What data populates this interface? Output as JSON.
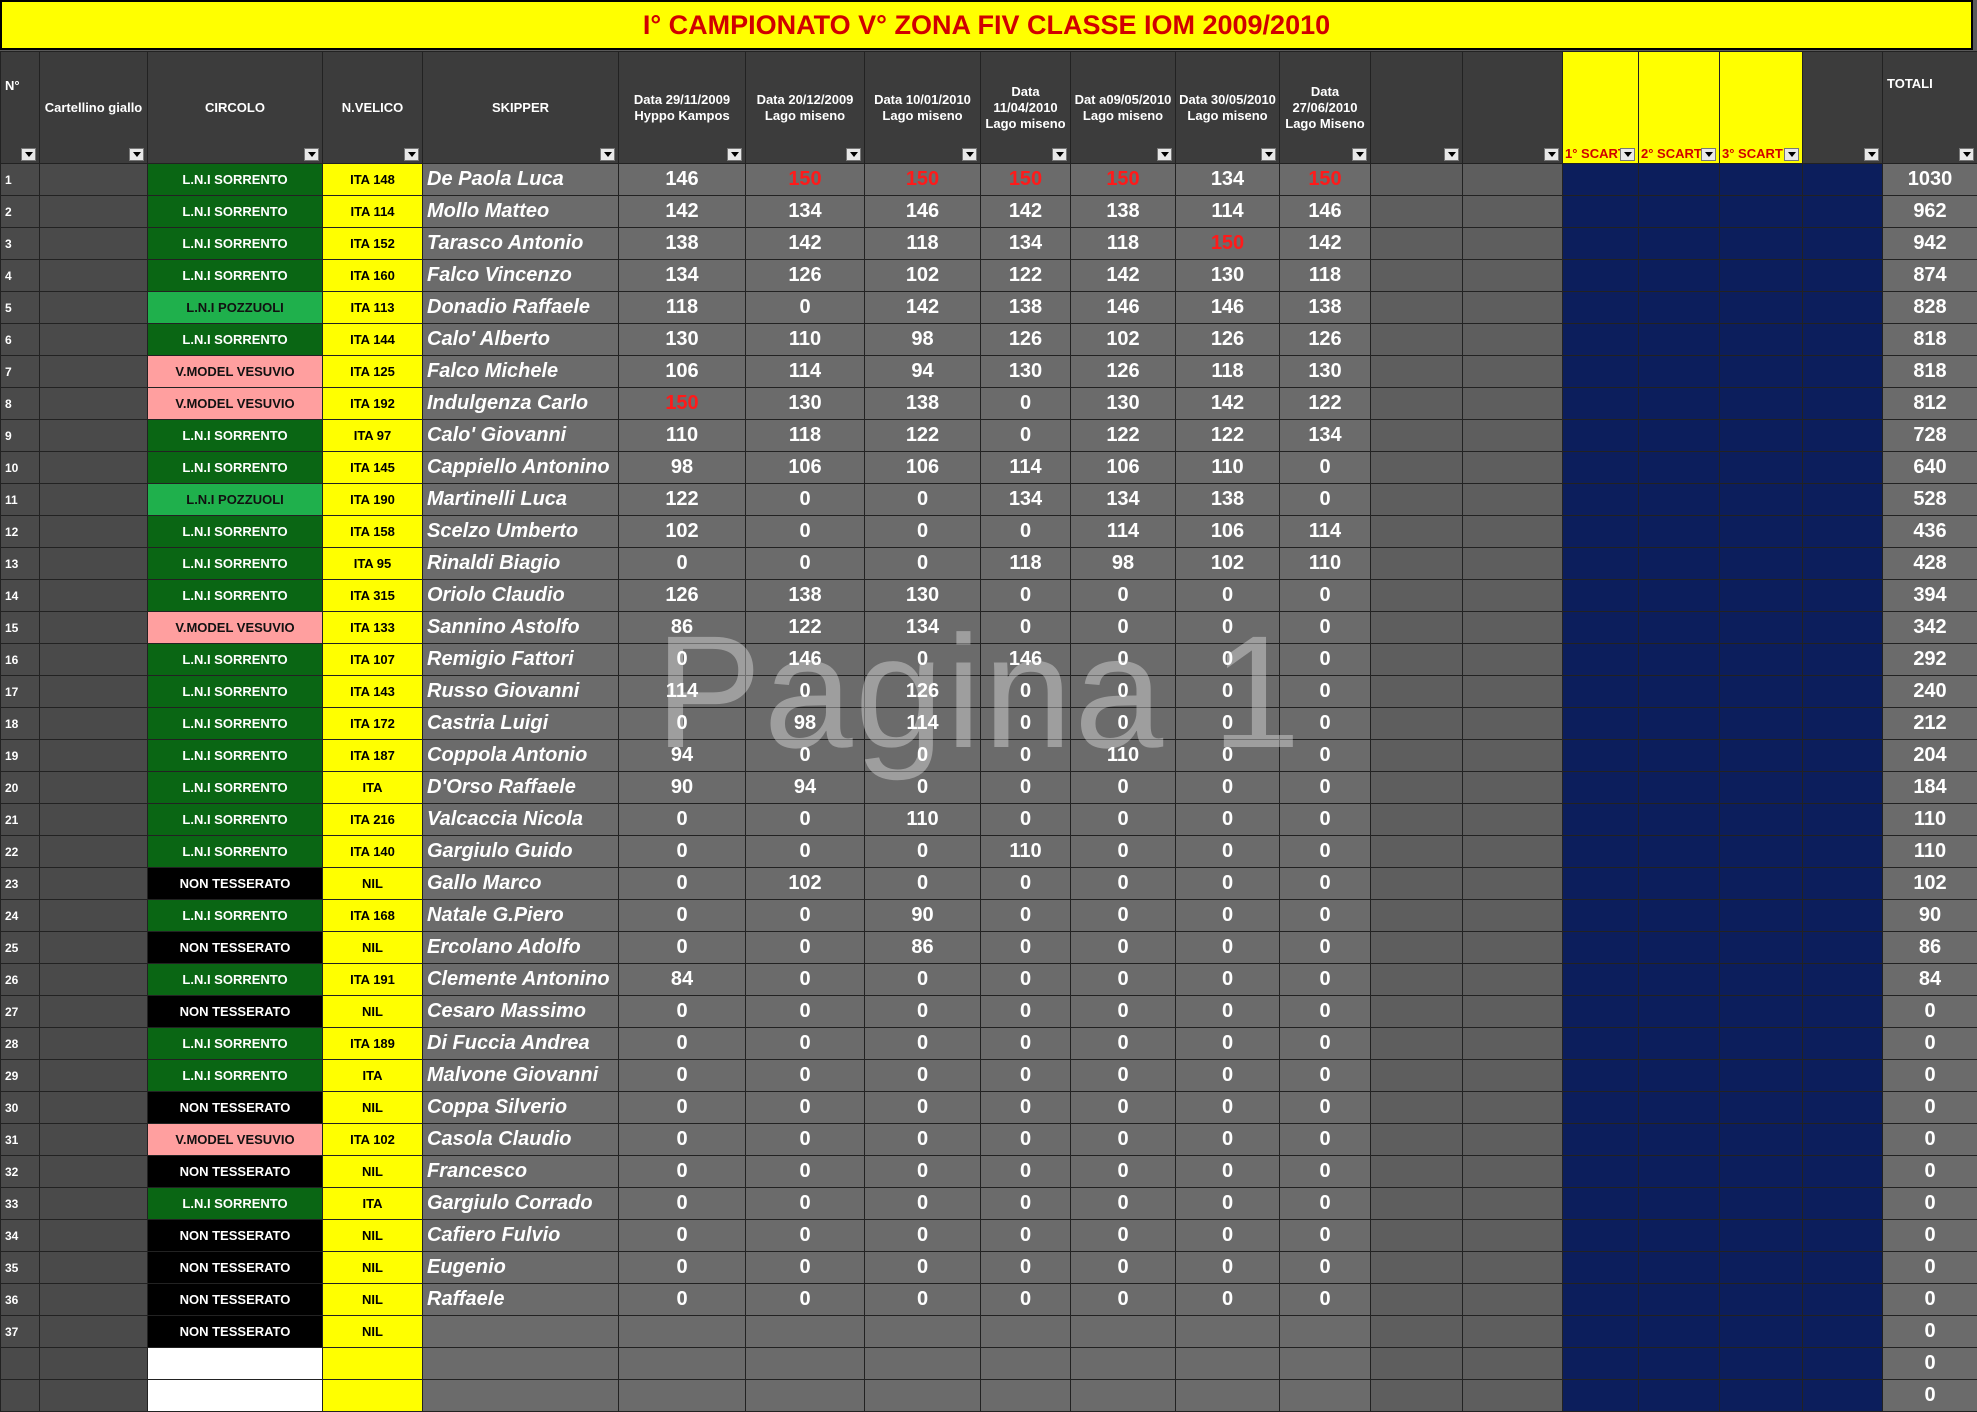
{
  "title": "I° CAMPIONATO  V° ZONA FIV CLASSE IOM 2009/2010",
  "watermark": "Pagina 1",
  "headers": {
    "no": "N°",
    "cartellino": "Cartellino giallo",
    "circolo": "CIRCOLO",
    "velico": "N.VELICO",
    "skipper": "SKIPPER",
    "races": [
      "Data   29/11/2009 Hyppo Kampos",
      "Data   20/12/2009 Lago miseno",
      "Data   10/01/2010 Lago miseno",
      "Data 11/04/2010 Lago miseno",
      "Dat a09/05/2010 Lago miseno",
      "Data 30/05/2010 Lago miseno",
      "Data 27/06/2010 Lago Miseno"
    ],
    "scarto": [
      "1° SCART",
      "2° SCART",
      "3° SCART"
    ],
    "totali": "TOTALI"
  },
  "rows": [
    {
      "n": "1",
      "circolo": "L.N.I SORRENTO",
      "cl": "sorrento",
      "velico": "ITA 148",
      "skipper": "De Paola Luca",
      "scores": [
        "146",
        "150",
        "150",
        "150",
        "150",
        "134",
        "150"
      ],
      "red": [
        1,
        2,
        3,
        4,
        6
      ],
      "tot": "1030"
    },
    {
      "n": "2",
      "circolo": "L.N.I SORRENTO",
      "cl": "sorrento",
      "velico": "ITA 114",
      "skipper": "Mollo Matteo",
      "scores": [
        "142",
        "134",
        "146",
        "142",
        "138",
        "114",
        "146"
      ],
      "red": [],
      "tot": "962"
    },
    {
      "n": "3",
      "circolo": "L.N.I SORRENTO",
      "cl": "sorrento",
      "velico": "ITA 152",
      "skipper": "Tarasco Antonio",
      "scores": [
        "138",
        "142",
        "118",
        "134",
        "118",
        "150",
        "142"
      ],
      "red": [
        5
      ],
      "tot": "942"
    },
    {
      "n": "4",
      "circolo": "L.N.I SORRENTO",
      "cl": "sorrento",
      "velico": "ITA 160",
      "skipper": "Falco Vincenzo",
      "scores": [
        "134",
        "126",
        "102",
        "122",
        "142",
        "130",
        "118"
      ],
      "red": [],
      "tot": "874"
    },
    {
      "n": "5",
      "circolo": "L.N.I POZZUOLI",
      "cl": "pozzuoli",
      "velico": "ITA 113",
      "skipper": "Donadio Raffaele",
      "scores": [
        "118",
        "0",
        "142",
        "138",
        "146",
        "146",
        "138"
      ],
      "red": [],
      "tot": "828"
    },
    {
      "n": "6",
      "circolo": "L.N.I SORRENTO",
      "cl": "sorrento",
      "velico": "ITA 144",
      "skipper": "Calo' Alberto",
      "scores": [
        "130",
        "110",
        "98",
        "126",
        "102",
        "126",
        "126"
      ],
      "red": [],
      "tot": "818"
    },
    {
      "n": "7",
      "circolo": "V.MODEL VESUVIO",
      "cl": "vesuvio",
      "velico": "ITA 125",
      "skipper": "Falco Michele",
      "scores": [
        "106",
        "114",
        "94",
        "130",
        "126",
        "118",
        "130"
      ],
      "red": [],
      "tot": "818"
    },
    {
      "n": "8",
      "circolo": "V.MODEL VESUVIO",
      "cl": "vesuvio",
      "velico": "ITA 192",
      "skipper": "Indulgenza Carlo",
      "scores": [
        "150",
        "130",
        "138",
        "0",
        "130",
        "142",
        "122"
      ],
      "red": [
        0
      ],
      "tot": "812"
    },
    {
      "n": "9",
      "circolo": "L.N.I SORRENTO",
      "cl": "sorrento",
      "velico": "ITA 97",
      "skipper": "Calo' Giovanni",
      "scores": [
        "110",
        "118",
        "122",
        "0",
        "122",
        "122",
        "134"
      ],
      "red": [],
      "tot": "728"
    },
    {
      "n": "10",
      "circolo": "L.N.I SORRENTO",
      "cl": "sorrento",
      "velico": "ITA 145",
      "skipper": "Cappiello Antonino",
      "scores": [
        "98",
        "106",
        "106",
        "114",
        "106",
        "110",
        "0"
      ],
      "red": [],
      "tot": "640"
    },
    {
      "n": "11",
      "circolo": "L.N.I POZZUOLI",
      "cl": "pozzuoli",
      "velico": "ITA 190",
      "skipper": "Martinelli Luca",
      "scores": [
        "122",
        "0",
        "0",
        "134",
        "134",
        "138",
        "0"
      ],
      "red": [],
      "tot": "528"
    },
    {
      "n": "12",
      "circolo": "L.N.I SORRENTO",
      "cl": "sorrento",
      "velico": "ITA 158",
      "skipper": "Scelzo Umberto",
      "scores": [
        "102",
        "0",
        "0",
        "0",
        "114",
        "106",
        "114"
      ],
      "red": [],
      "tot": "436"
    },
    {
      "n": "13",
      "circolo": "L.N.I SORRENTO",
      "cl": "sorrento",
      "velico": "ITA 95",
      "skipper": "Rinaldi Biagio",
      "scores": [
        "0",
        "0",
        "0",
        "118",
        "98",
        "102",
        "110"
      ],
      "red": [],
      "tot": "428"
    },
    {
      "n": "14",
      "circolo": "L.N.I SORRENTO",
      "cl": "sorrento",
      "velico": "ITA 315",
      "skipper": "Oriolo Claudio",
      "scores": [
        "126",
        "138",
        "130",
        "0",
        "0",
        "0",
        "0"
      ],
      "red": [],
      "tot": "394"
    },
    {
      "n": "15",
      "circolo": "V.MODEL VESUVIO",
      "cl": "vesuvio",
      "velico": "ITA 133",
      "skipper": "Sannino Astolfo",
      "scores": [
        "86",
        "122",
        "134",
        "0",
        "0",
        "0",
        "0"
      ],
      "red": [],
      "tot": "342"
    },
    {
      "n": "16",
      "circolo": "L.N.I SORRENTO",
      "cl": "sorrento",
      "velico": "ITA 107",
      "skipper": "Remigio Fattori",
      "scores": [
        "0",
        "146",
        "0",
        "146",
        "0",
        "0",
        "0"
      ],
      "red": [],
      "tot": "292"
    },
    {
      "n": "17",
      "circolo": "L.N.I SORRENTO",
      "cl": "sorrento",
      "velico": "ITA 143",
      "skipper": "Russo Giovanni",
      "scores": [
        "114",
        "0",
        "126",
        "0",
        "0",
        "0",
        "0"
      ],
      "red": [],
      "tot": "240"
    },
    {
      "n": "18",
      "circolo": "L.N.I SORRENTO",
      "cl": "sorrento",
      "velico": "ITA 172",
      "skipper": "Castria Luigi",
      "scores": [
        "0",
        "98",
        "114",
        "0",
        "0",
        "0",
        "0"
      ],
      "red": [],
      "tot": "212"
    },
    {
      "n": "19",
      "circolo": "L.N.I SORRENTO",
      "cl": "sorrento",
      "velico": "ITA 187",
      "skipper": "Coppola Antonio",
      "scores": [
        "94",
        "0",
        "0",
        "0",
        "110",
        "0",
        "0"
      ],
      "red": [],
      "tot": "204"
    },
    {
      "n": "20",
      "circolo": "L.N.I SORRENTO",
      "cl": "sorrento",
      "velico": "ITA",
      "skipper": "D'Orso Raffaele",
      "scores": [
        "90",
        "94",
        "0",
        "0",
        "0",
        "0",
        "0"
      ],
      "red": [],
      "tot": "184"
    },
    {
      "n": "21",
      "circolo": "L.N.I SORRENTO",
      "cl": "sorrento",
      "velico": "ITA 216",
      "skipper": "Valcaccia Nicola",
      "scores": [
        "0",
        "0",
        "110",
        "0",
        "0",
        "0",
        "0"
      ],
      "red": [],
      "tot": "110"
    },
    {
      "n": "22",
      "circolo": "L.N.I SORRENTO",
      "cl": "sorrento",
      "velico": "ITA 140",
      "skipper": "Gargiulo Guido",
      "scores": [
        "0",
        "0",
        "0",
        "110",
        "0",
        "0",
        "0"
      ],
      "red": [],
      "tot": "110"
    },
    {
      "n": "23",
      "circolo": "NON TESSERATO",
      "cl": "nontess",
      "velico": "NIL",
      "skipper": "Gallo Marco",
      "scores": [
        "0",
        "102",
        "0",
        "0",
        "0",
        "0",
        "0"
      ],
      "red": [],
      "tot": "102"
    },
    {
      "n": "24",
      "circolo": "L.N.I SORRENTO",
      "cl": "sorrento",
      "velico": "ITA 168",
      "skipper": "Natale G.Piero",
      "scores": [
        "0",
        "0",
        "90",
        "0",
        "0",
        "0",
        "0"
      ],
      "red": [],
      "tot": "90"
    },
    {
      "n": "25",
      "circolo": "NON TESSERATO",
      "cl": "nontess",
      "velico": "NIL",
      "skipper": "Ercolano Adolfo",
      "scores": [
        "0",
        "0",
        "86",
        "0",
        "0",
        "0",
        "0"
      ],
      "red": [],
      "tot": "86"
    },
    {
      "n": "26",
      "circolo": "L.N.I SORRENTO",
      "cl": "sorrento",
      "velico": "ITA 191",
      "skipper": "Clemente Antonino",
      "scores": [
        "84",
        "0",
        "0",
        "0",
        "0",
        "0",
        "0"
      ],
      "red": [],
      "tot": "84"
    },
    {
      "n": "27",
      "circolo": "NON TESSERATO",
      "cl": "nontess",
      "velico": "NIL",
      "skipper": "Cesaro Massimo",
      "scores": [
        "0",
        "0",
        "0",
        "0",
        "0",
        "0",
        "0"
      ],
      "red": [],
      "tot": "0"
    },
    {
      "n": "28",
      "circolo": "L.N.I SORRENTO",
      "cl": "sorrento",
      "velico": "ITA 189",
      "skipper": "Di Fuccia Andrea",
      "scores": [
        "0",
        "0",
        "0",
        "0",
        "0",
        "0",
        "0"
      ],
      "red": [],
      "tot": "0"
    },
    {
      "n": "29",
      "circolo": "L.N.I SORRENTO",
      "cl": "sorrento",
      "velico": "ITA",
      "skipper": "Malvone Giovanni",
      "scores": [
        "0",
        "0",
        "0",
        "0",
        "0",
        "0",
        "0"
      ],
      "red": [],
      "tot": "0"
    },
    {
      "n": "30",
      "circolo": "NON TESSERATO",
      "cl": "nontess",
      "velico": "NIL",
      "skipper": "Coppa Silverio",
      "scores": [
        "0",
        "0",
        "0",
        "0",
        "0",
        "0",
        "0"
      ],
      "red": [],
      "tot": "0"
    },
    {
      "n": "31",
      "circolo": "V.MODEL VESUVIO",
      "cl": "vesuvio",
      "velico": "ITA 102",
      "skipper": "Casola Claudio",
      "scores": [
        "0",
        "0",
        "0",
        "0",
        "0",
        "0",
        "0"
      ],
      "red": [],
      "tot": "0"
    },
    {
      "n": "32",
      "circolo": "NON TESSERATO",
      "cl": "nontess",
      "velico": "NIL",
      "skipper": "Francesco",
      "scores": [
        "0",
        "0",
        "0",
        "0",
        "0",
        "0",
        "0"
      ],
      "red": [],
      "tot": "0"
    },
    {
      "n": "33",
      "circolo": "L.N.I SORRENTO",
      "cl": "sorrento",
      "velico": "ITA",
      "skipper": "Gargiulo Corrado",
      "scores": [
        "0",
        "0",
        "0",
        "0",
        "0",
        "0",
        "0"
      ],
      "red": [],
      "tot": "0"
    },
    {
      "n": "34",
      "circolo": "NON TESSERATO",
      "cl": "nontess",
      "velico": "NIL",
      "skipper": "Cafiero Fulvio",
      "scores": [
        "0",
        "0",
        "0",
        "0",
        "0",
        "0",
        "0"
      ],
      "red": [],
      "tot": "0"
    },
    {
      "n": "35",
      "circolo": "NON TESSERATO",
      "cl": "nontess",
      "velico": "NIL",
      "skipper": "Eugenio",
      "scores": [
        "0",
        "0",
        "0",
        "0",
        "0",
        "0",
        "0"
      ],
      "red": [],
      "tot": "0"
    },
    {
      "n": "36",
      "circolo": "NON TESSERATO",
      "cl": "nontess",
      "velico": "NIL",
      "skipper": "Raffaele",
      "scores": [
        "0",
        "0",
        "0",
        "0",
        "0",
        "0",
        "0"
      ],
      "red": [],
      "tot": "0"
    },
    {
      "n": "37",
      "circolo": "NON TESSERATO",
      "cl": "nontess",
      "velico": "NIL",
      "skipper": "",
      "scores": [
        "",
        "",
        "",
        "",
        "",
        "",
        ""
      ],
      "red": [],
      "tot": "0"
    },
    {
      "n": "",
      "circolo": "",
      "cl": "blank",
      "velico": "",
      "skipper": "",
      "scores": [
        "",
        "",
        "",
        "",
        "",
        "",
        ""
      ],
      "red": [],
      "tot": "0"
    },
    {
      "n": "",
      "circolo": "",
      "cl": "blank",
      "velico": "",
      "skipper": "",
      "scores": [
        "",
        "",
        "",
        "",
        "",
        "",
        ""
      ],
      "red": [],
      "tot": "0"
    }
  ]
}
